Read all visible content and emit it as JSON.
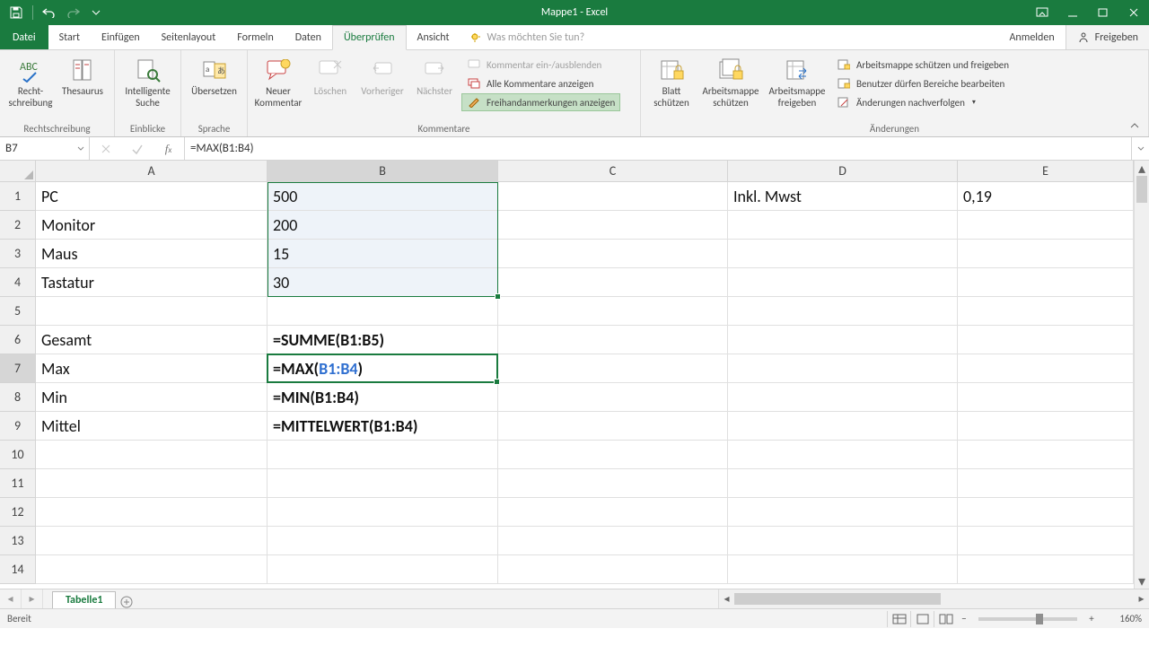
{
  "app": {
    "title": "Mappe1 - Excel"
  },
  "tabs": {
    "file": "Datei",
    "items": [
      "Start",
      "Einfügen",
      "Seitenlayout",
      "Formeln",
      "Daten",
      "Überprüfen",
      "Ansicht"
    ],
    "active": "Überprüfen",
    "tellme": "Was möchten Sie tun?",
    "signin": "Anmelden",
    "share": "Freigeben"
  },
  "ribbon": {
    "proofing": {
      "spell": "Recht-\nschreibung",
      "thesaurus": "Thesaurus",
      "label": "Rechtschreibung"
    },
    "insights": {
      "smart": "Intelligente\nSuche",
      "label": "Einblicke"
    },
    "language": {
      "translate": "Übersetzen",
      "label": "Sprache"
    },
    "comments": {
      "new": "Neuer\nKommentar",
      "del": "Löschen",
      "prev": "Vorheriger",
      "next": "Nächster",
      "toggle": "Kommentar ein-/ausblenden",
      "showall": "Alle Kommentare anzeigen",
      "ink": "Freihandanmerkungen anzeigen",
      "label": "Kommentare"
    },
    "protect": {
      "sheet": "Blatt\nschützen",
      "wb": "Arbeitsmappe\nschützen",
      "sharewb": "Arbeitsmappe\nfreigeben",
      "protectshare": "Arbeitsmappe schützen und freigeben",
      "allowranges": "Benutzer dürfen Bereiche bearbeiten",
      "track": "Änderungen nachverfolgen",
      "label": "Änderungen"
    }
  },
  "fx": {
    "name": "B7",
    "formula": "=MAX(B1:B4)"
  },
  "columns": [
    "A",
    "B",
    "C",
    "D",
    "E"
  ],
  "selection": {
    "active_col": "B",
    "active_row": 7,
    "ref_range": "B1:B4"
  },
  "cells": {
    "A1": "PC",
    "B1": "500",
    "D1": "Inkl. Mwst",
    "E1": "0,19",
    "A2": "Monitor",
    "B2": "200",
    "A3": "Maus",
    "B3": "15",
    "A4": "Tastatur",
    "B4": "30",
    "A6": "Gesamt",
    "B6": "=SUMME(B1:B5)",
    "A7": "Max",
    "B7_pre": "=MAX(",
    "B7_ref": "B1:B4",
    "B7_post": ")",
    "A8": "Min",
    "B8": "=MIN(B1:B4)",
    "A9": "Mittel",
    "B9": "=MITTELWERT(B1:B4)"
  },
  "sheets": {
    "tab1": "Tabelle1"
  },
  "status": {
    "ready": "Bereit",
    "zoom": "160%"
  }
}
